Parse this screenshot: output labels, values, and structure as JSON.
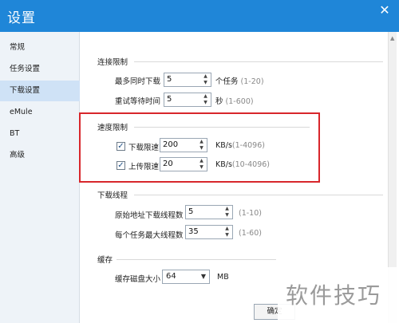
{
  "window": {
    "title": "设置"
  },
  "sidebar": {
    "items": [
      {
        "label": "常规"
      },
      {
        "label": "任务设置"
      },
      {
        "label": "下载设置",
        "active": true
      },
      {
        "label": "eMule"
      },
      {
        "label": "BT"
      },
      {
        "label": "高级"
      }
    ]
  },
  "connection": {
    "title": "连接限制",
    "max_downloads": {
      "label": "最多同时下载",
      "value": "5",
      "unit": "个任务",
      "range": "(1-20)"
    },
    "retry_wait": {
      "label": "重试等待时间",
      "value": "5",
      "unit": "秒",
      "range": "(1-600)"
    }
  },
  "speed": {
    "title": "速度限制",
    "download": {
      "label": "下载限速",
      "checked": true,
      "value": "200",
      "unit": "KB/s",
      "range": "(1-4096)"
    },
    "upload": {
      "label": "上传限速",
      "checked": true,
      "value": "20",
      "unit": "KB/s",
      "range": "(10-4096)"
    }
  },
  "threads": {
    "title": "下载线程",
    "origin": {
      "label": "原始地址下载线程数",
      "value": "5",
      "range": "(1-10)"
    },
    "per_task": {
      "label": "每个任务最大线程数",
      "value": "35",
      "range": "(1-60)"
    }
  },
  "cache": {
    "title": "缓存",
    "disk": {
      "label": "缓存磁盘大小",
      "value": "64",
      "unit": "MB"
    }
  },
  "footer": {
    "confirm_label": "确定"
  },
  "watermark": {
    "text": "软件技巧"
  },
  "colors": {
    "titlebar": "#1f86d8",
    "highlight": "#d8262b",
    "active_nav": "#cfe2f6"
  }
}
